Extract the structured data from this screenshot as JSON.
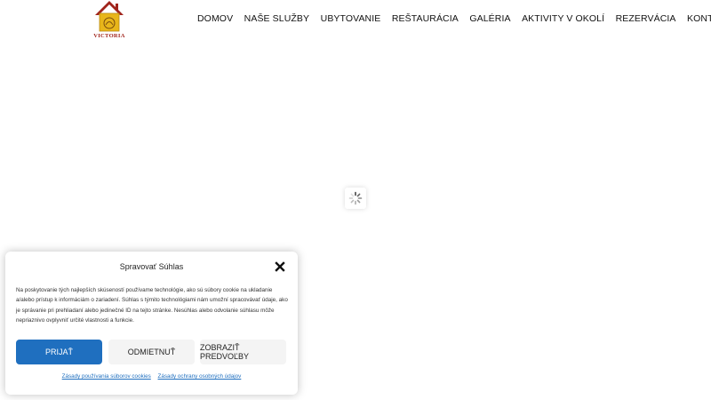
{
  "header": {
    "logo_text": "VICTORIA",
    "logo_script": "Villa",
    "nav": [
      {
        "label": "DOMOV"
      },
      {
        "label": "NAŠE SLUŽBY"
      },
      {
        "label": "UBYTOVANIE"
      },
      {
        "label": "REŠTAURÁCIA"
      },
      {
        "label": "GALÉRIA"
      },
      {
        "label": "AKTIVITY V OKOLÍ"
      },
      {
        "label": "REZERVÁCIA"
      },
      {
        "label": "KONTAKT"
      }
    ]
  },
  "cookie": {
    "title": "Spravovať Súhlas",
    "body": "Na poskytovanie tých najlepších skúseností používame technológie, ako sú súbory cookie na ukladanie a/alebo prístup k informáciám o zariadení. Súhlas s týmito technológiami nám umožní spracovávať údaje, ako je správanie pri prehliadaní alebo jedinečné ID na tejto stránke. Nesúhlas alebo odvolanie súhlasu môže nepriaznivo ovplyvniť určité vlastnosti a funkcie.",
    "accept_label": "Prijať",
    "deny_label": "Odmietnuť",
    "prefs_label": "Zobraziť predvoľby",
    "cookie_policy_link": "Zásady používania súborov cookies",
    "privacy_link": "Zásady ochrany osobných údajov"
  },
  "icons": {
    "close": "close-icon",
    "loader": "spinner-icon",
    "logo": "house-logo-icon"
  },
  "colors": {
    "accent": "#1f6fbf",
    "logo_yellow": "#e8b61a",
    "logo_red": "#a0241c"
  }
}
